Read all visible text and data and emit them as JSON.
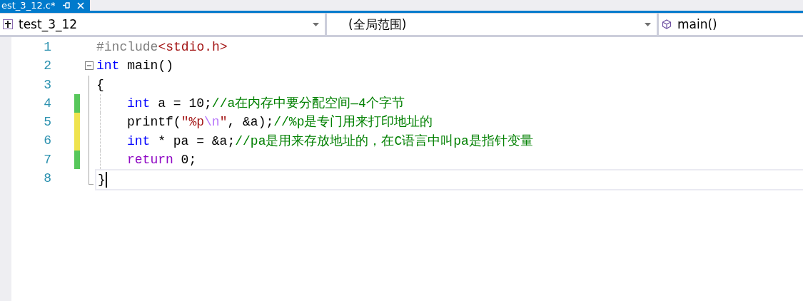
{
  "tab": {
    "title": "est_3_12.c*",
    "selected": true
  },
  "nav": [
    {
      "kind": "project",
      "text": "test_3_12"
    },
    {
      "kind": "scope",
      "text": "(全局范围)"
    },
    {
      "kind": "member",
      "text": "main()"
    }
  ],
  "lines": [
    {
      "number": "1",
      "changed": false,
      "expanded": false,
      "in_block": false,
      "block_end": false,
      "indented": false,
      "guide": false,
      "current": false,
      "tokens": [
        {
          "kind": "macro",
          "text": "#include"
        },
        {
          "kind": "string",
          "text": "<stdio.h>"
        }
      ]
    },
    {
      "number": "2",
      "changed": false,
      "expanded": true,
      "in_block": false,
      "block_end": false,
      "indented": false,
      "guide": false,
      "current": false,
      "tokens": [
        {
          "kind": "keyword",
          "text": "int"
        },
        {
          "kind": "plain",
          "text": " main()"
        }
      ]
    },
    {
      "number": "3",
      "changed": false,
      "expanded": false,
      "in_block": true,
      "block_end": false,
      "indented": false,
      "guide": false,
      "current": false,
      "tokens": [
        {
          "kind": "plain",
          "text": "{"
        }
      ]
    },
    {
      "number": "4",
      "changed": true,
      "color": "#57c75b",
      "expanded": false,
      "in_block": true,
      "block_end": false,
      "indented": true,
      "guide": true,
      "current": false,
      "tokens": [
        {
          "kind": "keyword",
          "text": "int"
        },
        {
          "kind": "plain",
          "text": " a = 10;"
        },
        {
          "kind": "comment",
          "text": "//a在内存中要分配空间—4个字节"
        }
      ]
    },
    {
      "number": "5",
      "changed": true,
      "color": "#efe34f",
      "expanded": false,
      "in_block": true,
      "block_end": false,
      "indented": true,
      "guide": true,
      "current": false,
      "tokens": [
        {
          "kind": "plain",
          "text": "printf("
        },
        {
          "kind": "string",
          "text": "\"%p"
        },
        {
          "kind": "escape",
          "text": "\\n"
        },
        {
          "kind": "string",
          "text": "\""
        },
        {
          "kind": "plain",
          "text": ", &a);"
        },
        {
          "kind": "comment",
          "text": "//%p是专门用来打印地址的"
        }
      ]
    },
    {
      "number": "6",
      "changed": true,
      "color": "#efe34f",
      "expanded": false,
      "in_block": true,
      "block_end": false,
      "indented": true,
      "guide": true,
      "current": false,
      "tokens": [
        {
          "kind": "keyword",
          "text": "int"
        },
        {
          "kind": "plain",
          "text": " * pa = &a;"
        },
        {
          "kind": "comment",
          "text": "//pa是用来存放地址的，在C语言中叫pa是指针变量"
        }
      ]
    },
    {
      "number": "7",
      "changed": true,
      "color": "#57c75b",
      "expanded": false,
      "in_block": true,
      "block_end": false,
      "indented": true,
      "guide": true,
      "current": false,
      "tokens": [
        {
          "kind": "control",
          "text": "return"
        },
        {
          "kind": "plain",
          "text": " 0;"
        }
      ]
    },
    {
      "number": "8",
      "changed": false,
      "expanded": false,
      "in_block": false,
      "block_end": true,
      "indented": false,
      "guide": false,
      "current": true,
      "tokens": [
        {
          "kind": "plain",
          "text": "}"
        }
      ]
    }
  ]
}
